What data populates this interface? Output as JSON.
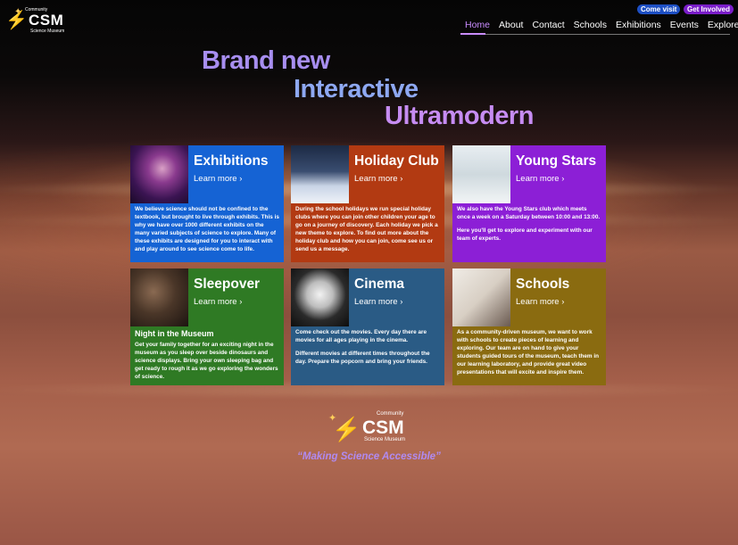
{
  "brand": {
    "small": "Community",
    "name": "CSM",
    "sub": "Science Museum"
  },
  "header": {
    "come_visit": "Come visit",
    "get_involved": "Get Involved"
  },
  "nav": {
    "items": [
      "Home",
      "About",
      "Contact",
      "Schools",
      "Exhibitions",
      "Events",
      "Explore"
    ],
    "active": "Home"
  },
  "hero": {
    "line1": "Brand new",
    "line2": "Interactive",
    "line3": "Ultramodern"
  },
  "cards": [
    {
      "title": "Exhibitions",
      "link": "Learn more ›",
      "subheading": "",
      "paragraphs": [
        "We believe science should not be confined to the textbook, but brought to live through exhibits. This is why we have over 1000 different exhibits on the many varied subjects of science to explore. Many of these exhibits are designed for you to interact with and play around to see science come to life."
      ],
      "color": "#1563d4"
    },
    {
      "title": "Holiday Club",
      "link": "Learn more ›",
      "subheading": "",
      "paragraphs": [
        "During the school holidays we run special holiday clubs where you can join other children your age to go on a journey of discovery. Each holiday we pick a new theme to explore. To find out more about the holiday club and how you can join, come see us or send us a message."
      ],
      "color": "#b23a12"
    },
    {
      "title": "Young Stars",
      "link": "Learn more ›",
      "subheading": "",
      "paragraphs": [
        "We also have the Young Stars club which meets once a week on a Saturday between 10:00 and 13:00.",
        "Here you'll get to explore and experiment with our team of experts."
      ],
      "color": "#8c1fd6"
    },
    {
      "title": "Sleepover",
      "link": "Learn more ›",
      "subheading": "Night in the Museum",
      "paragraphs": [
        "Get your family together for an exciting night in the museum as you sleep over beside dinosaurs and science displays. Bring your own sleeping bag and get ready to rough it as we go exploring the wonders of science."
      ],
      "color": "#2f7a24"
    },
    {
      "title": "Cinema",
      "link": "Learn more ›",
      "subheading": "",
      "paragraphs": [
        "Come check out the movies. Every day there are movies for all ages playing in the cinema.",
        "Different movies at different times throughout the day. Prepare the popcorn and bring your friends."
      ],
      "color": "#2a5b85"
    },
    {
      "title": "Schools",
      "link": "Learn more ›",
      "subheading": "",
      "paragraphs": [
        "As a community-driven museum, we want to work with schools to create pieces of learning and exploring. Our team are on hand to give your students guided tours of the museum, teach them in our learning laboratory, and provide great video presentations that will excite and inspire them."
      ],
      "color": "#8a6b10"
    }
  ],
  "footer": {
    "tagline": "“Making Science Accessible”"
  },
  "colors": {
    "accent_purple": "#c98cff",
    "pill_blue": "#1d4fc4",
    "pill_purple": "#7a1dc9"
  }
}
